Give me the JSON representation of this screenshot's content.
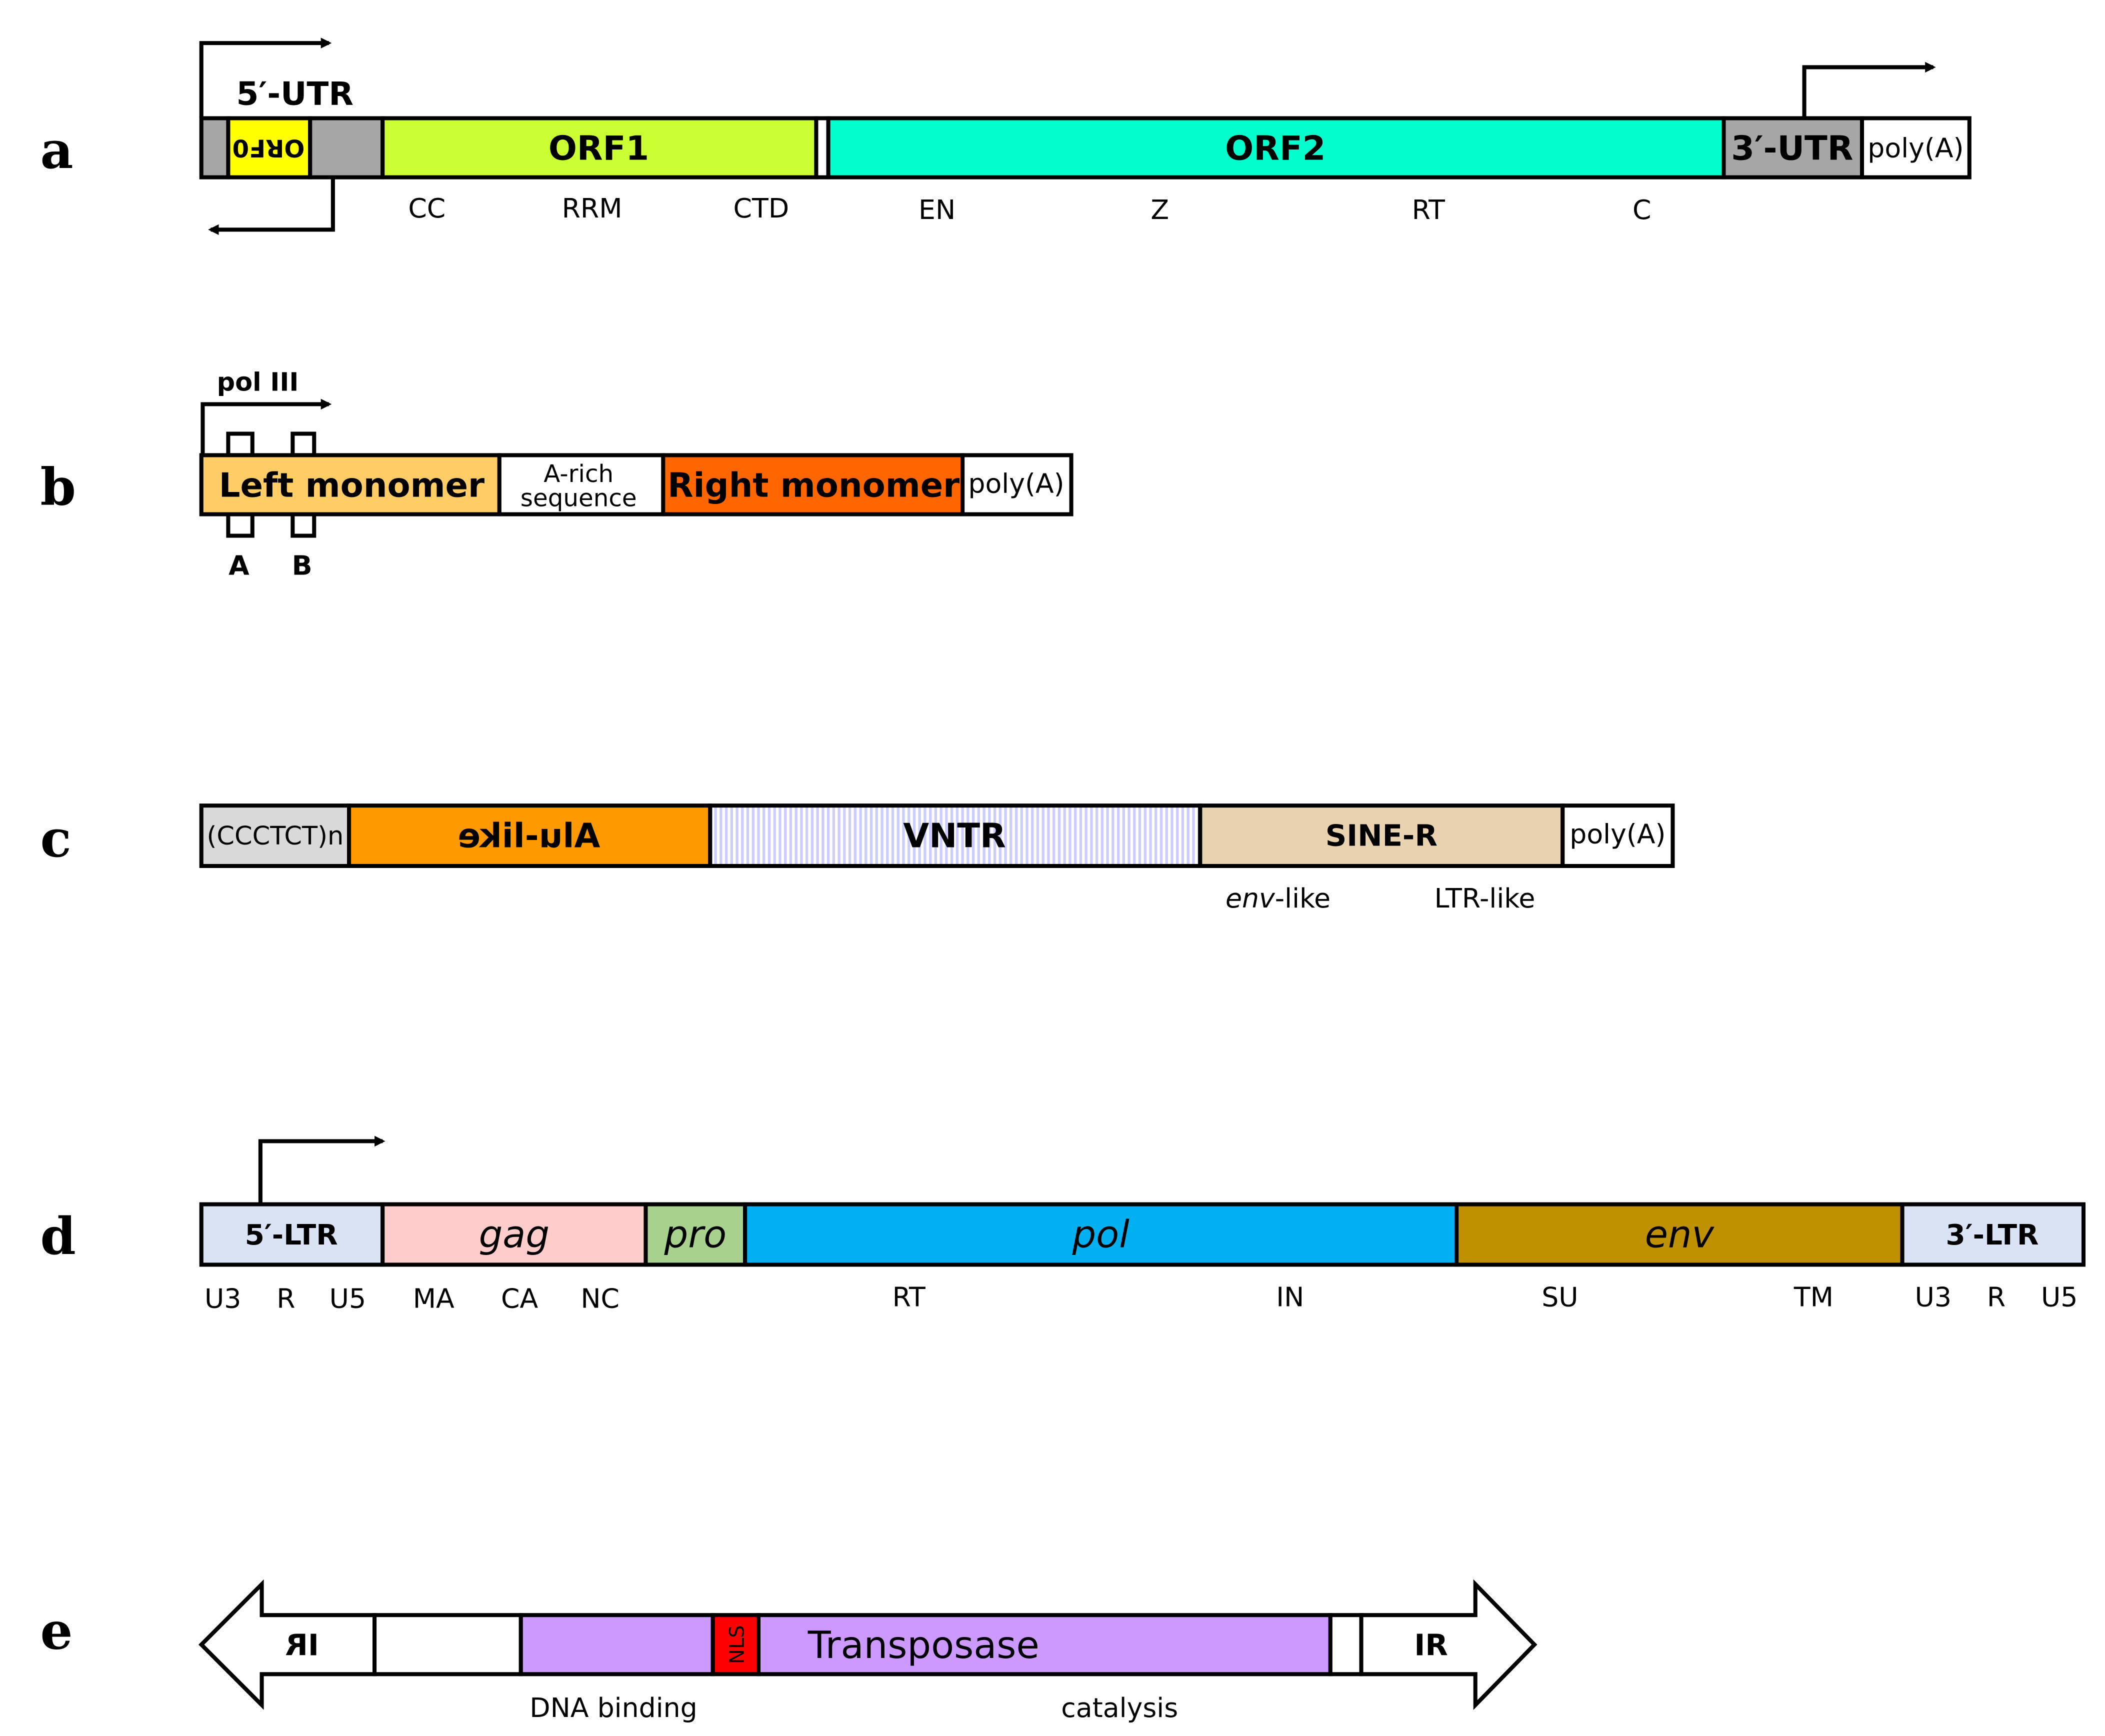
{
  "panels": {
    "a": {
      "letter": "a",
      "utr5": "5′-UTR",
      "orf0": "ORF0",
      "orf1": "ORF1",
      "orf2": "ORF2",
      "utr3": "3′-UTR",
      "polya": "poly(A)",
      "domains": [
        "CC",
        "RRM",
        "CTD",
        "EN",
        "Z",
        "RT",
        "C"
      ],
      "colors": {
        "utr": "#a6a6a6",
        "orf0": "#ffff00",
        "orf1": "#ccff33",
        "orf2": "#00ffcc"
      }
    },
    "b": {
      "letter": "b",
      "promoter": "pol III",
      "left": "Left monomer",
      "arich_1": "A-rich",
      "arich_2": "sequence",
      "right": "Right monomer",
      "polya": "poly(A)",
      "box_a": "A",
      "box_b": "B",
      "colors": {
        "left": "#ffcc66",
        "right": "#ff6600"
      }
    },
    "c": {
      "letter": "c",
      "hex": "(CCCTCT)n",
      "alu": "Alu-like",
      "vntr": "VNTR",
      "siner": "SINE-R",
      "polya": "poly(A)",
      "env_italic": "env",
      "env_suffix": "-like",
      "ltr_like": "LTR-like",
      "colors": {
        "hex": "#d9d9d9",
        "alu": "#ff9900",
        "vntr": "#ccccff",
        "siner": "#e8d2b0"
      }
    },
    "d": {
      "letter": "d",
      "ltr5": "5′-LTR",
      "gag": "gag",
      "pro": "pro",
      "pol": "pol",
      "env": "env",
      "ltr3": "3′-LTR",
      "sub": [
        "U3",
        "R",
        "U5",
        "MA",
        "CA",
        "NC",
        "RT",
        "IN",
        "SU",
        "TM",
        "U3",
        "R",
        "U5"
      ],
      "colors": {
        "ltr": "#dae3f3",
        "gag": "#ffcccc",
        "pro": "#a9d18e",
        "pol": "#00b0f0",
        "env": "#bf9000"
      }
    },
    "e": {
      "letter": "e",
      "ir_left": "IR",
      "ir_right": "IR",
      "nls": "NLS",
      "transposase": "Transposase",
      "dna_binding": "DNA binding",
      "catalysis": "catalysis",
      "colors": {
        "transposase": "#cc99ff",
        "nls": "#ff0000"
      }
    }
  }
}
